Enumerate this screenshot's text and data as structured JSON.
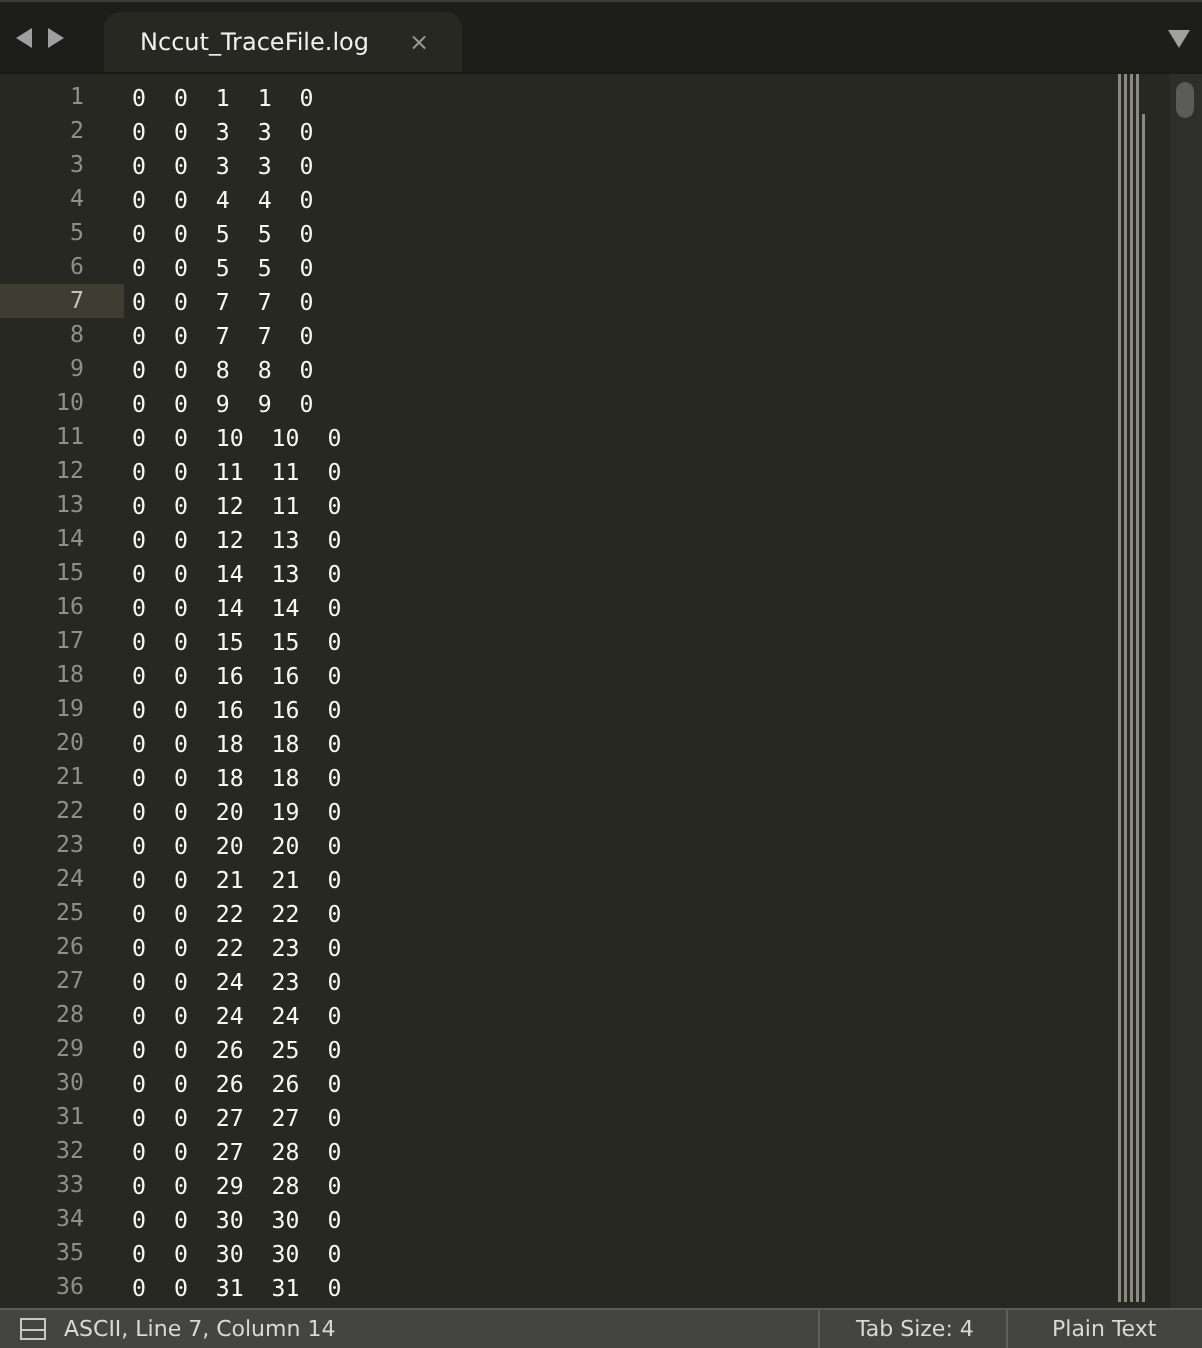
{
  "tabs": [
    {
      "title": "Nccut_TraceFile.log",
      "close": "×",
      "selected": true
    }
  ],
  "lines": [
    {
      "number": "1",
      "text": "0  0  1  1  0",
      "current": false
    },
    {
      "number": "2",
      "text": "0  0  3  3  0",
      "current": false
    },
    {
      "number": "3",
      "text": "0  0  3  3  0",
      "current": false
    },
    {
      "number": "4",
      "text": "0  0  4  4  0",
      "current": false
    },
    {
      "number": "5",
      "text": "0  0  5  5  0",
      "current": false
    },
    {
      "number": "6",
      "text": "0  0  5  5  0",
      "current": false
    },
    {
      "number": "7",
      "text": "0  0  7  7  0",
      "current": true
    },
    {
      "number": "8",
      "text": "0  0  7  7  0",
      "current": false
    },
    {
      "number": "9",
      "text": "0  0  8  8  0",
      "current": false
    },
    {
      "number": "10",
      "text": "0  0  9  9  0",
      "current": false
    },
    {
      "number": "11",
      "text": "0  0  10  10  0",
      "current": false
    },
    {
      "number": "12",
      "text": "0  0  11  11  0",
      "current": false
    },
    {
      "number": "13",
      "text": "0  0  12  11  0",
      "current": false
    },
    {
      "number": "14",
      "text": "0  0  12  13  0",
      "current": false
    },
    {
      "number": "15",
      "text": "0  0  14  13  0",
      "current": false
    },
    {
      "number": "16",
      "text": "0  0  14  14  0",
      "current": false
    },
    {
      "number": "17",
      "text": "0  0  15  15  0",
      "current": false
    },
    {
      "number": "18",
      "text": "0  0  16  16  0",
      "current": false
    },
    {
      "number": "19",
      "text": "0  0  16  16  0",
      "current": false
    },
    {
      "number": "20",
      "text": "0  0  18  18  0",
      "current": false
    },
    {
      "number": "21",
      "text": "0  0  18  18  0",
      "current": false
    },
    {
      "number": "22",
      "text": "0  0  20  19  0",
      "current": false
    },
    {
      "number": "23",
      "text": "0  0  20  20  0",
      "current": false
    },
    {
      "number": "24",
      "text": "0  0  21  21  0",
      "current": false
    },
    {
      "number": "25",
      "text": "0  0  22  22  0",
      "current": false
    },
    {
      "number": "26",
      "text": "0  0  22  23  0",
      "current": false
    },
    {
      "number": "27",
      "text": "0  0  24  23  0",
      "current": false
    },
    {
      "number": "28",
      "text": "0  0  24  24  0",
      "current": false
    },
    {
      "number": "29",
      "text": "0  0  26  25  0",
      "current": false
    },
    {
      "number": "30",
      "text": "0  0  26  26  0",
      "current": false
    },
    {
      "number": "31",
      "text": "0  0  27  27  0",
      "current": false
    },
    {
      "number": "32",
      "text": "0  0  27  28  0",
      "current": false
    },
    {
      "number": "33",
      "text": "0  0  29  28  0",
      "current": false
    },
    {
      "number": "34",
      "text": "0  0  30  30  0",
      "current": false
    },
    {
      "number": "35",
      "text": "0  0  30  30  0",
      "current": false
    },
    {
      "number": "36",
      "text": "0  0  31  31  0",
      "current": false
    }
  ],
  "status_bar": {
    "position": "ASCII, Line 7, Column 14",
    "tab_size": "Tab Size: 4",
    "syntax": "Plain Text"
  }
}
